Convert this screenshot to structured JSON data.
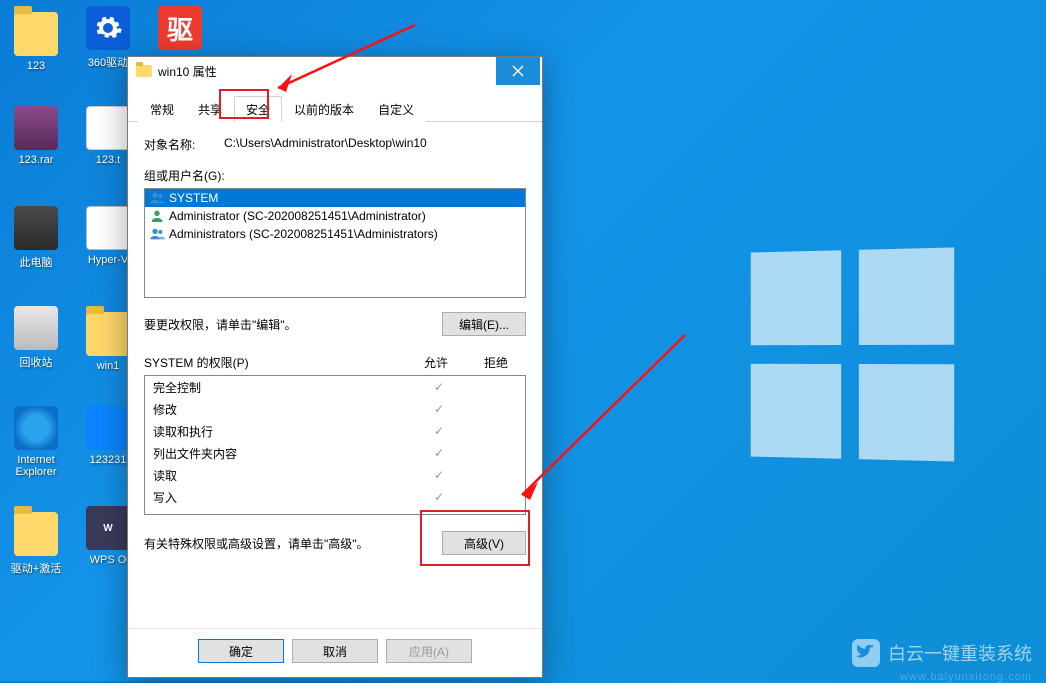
{
  "desktop": {
    "icons": [
      {
        "label": "123",
        "kind": "folder"
      },
      {
        "label": "360驱动",
        "kind": "gear"
      },
      {
        "label": "驱",
        "kind": "qu"
      },
      {
        "label": "123.rar",
        "kind": "rar"
      },
      {
        "label": "123.t",
        "kind": "txt"
      },
      {
        "label": "",
        "kind": "blank"
      },
      {
        "label": "此电脑",
        "kind": "pc"
      },
      {
        "label": "Hyper-V",
        "kind": "hv"
      },
      {
        "label": "",
        "kind": "blank"
      },
      {
        "label": "回收站",
        "kind": "bin"
      },
      {
        "label": "win1",
        "kind": "folder"
      },
      {
        "label": "",
        "kind": "blank"
      },
      {
        "label": "Internet Explorer",
        "kind": "ie"
      },
      {
        "label": "123231",
        "kind": "blue"
      },
      {
        "label": "",
        "kind": "blank"
      },
      {
        "label": "驱动+激活",
        "kind": "folder"
      },
      {
        "label": "WPS O",
        "kind": "wps"
      }
    ]
  },
  "watermark": {
    "text": "白云一键重装系统",
    "url": "www.baiyunxitong.com"
  },
  "dialog": {
    "title": "win10 属性",
    "tabs": [
      "常规",
      "共享",
      "安全",
      "以前的版本",
      "自定义"
    ],
    "active_tab": 2,
    "object_label": "对象名称:",
    "object_value": "C:\\Users\\Administrator\\Desktop\\win10",
    "group_label": "组或用户名(G):",
    "groups": [
      {
        "name": "SYSTEM",
        "type": "grp",
        "selected": true
      },
      {
        "name": "Administrator (SC-202008251451\\Administrator)",
        "type": "usr",
        "selected": false
      },
      {
        "name": "Administrators (SC-202008251451\\Administrators)",
        "type": "grp",
        "selected": false
      }
    ],
    "edit_hint": "要更改权限，请单击\"编辑\"。",
    "edit_btn": "编辑(E)...",
    "perm_title": "SYSTEM 的权限(P)",
    "perm_allow": "允许",
    "perm_deny": "拒绝",
    "perms": [
      {
        "name": "完全控制",
        "allow": true,
        "deny": false
      },
      {
        "name": "修改",
        "allow": true,
        "deny": false
      },
      {
        "name": "读取和执行",
        "allow": true,
        "deny": false
      },
      {
        "name": "列出文件夹内容",
        "allow": true,
        "deny": false
      },
      {
        "name": "读取",
        "allow": true,
        "deny": false
      },
      {
        "name": "写入",
        "allow": true,
        "deny": false
      }
    ],
    "adv_hint": "有关特殊权限或高级设置，请单击\"高级\"。",
    "adv_btn": "高级(V)",
    "ok_btn": "确定",
    "cancel_btn": "取消",
    "apply_btn": "应用(A)"
  }
}
